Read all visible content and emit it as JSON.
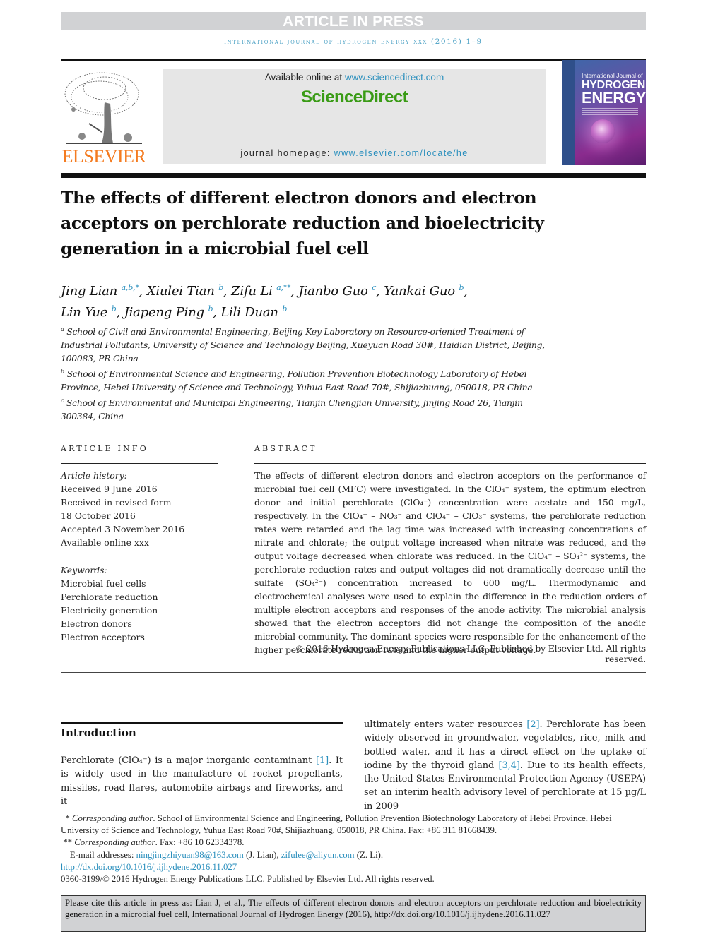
{
  "banner": {
    "label": "ARTICLE IN PRESS"
  },
  "journal_line": "international journal of hydrogen energy xxx (2016) 1–9",
  "header": {
    "publisher_logo_text": "ELSEVIER",
    "available_prefix": "Available online at ",
    "available_link": "www.sciencedirect.com",
    "sciencedirect_logo": "ScienceDirect",
    "homepage_prefix": "journal homepage: ",
    "homepage_link": "www.elsevier.com/locate/he",
    "cover": {
      "line1": "International Journal of",
      "line2": "HYDROGEN",
      "line3": "ENERGY"
    }
  },
  "title": "The effects of different electron donors and electron acceptors on perchlorate reduction and bioelectricity generation in a microbial fuel cell",
  "authors": [
    {
      "name": "Jing Lian",
      "sup": "a,b,*"
    },
    {
      "name": "Xiulei Tian",
      "sup": "b"
    },
    {
      "name": "Zifu Li",
      "sup": "a,**"
    },
    {
      "name": "Jianbo Guo",
      "sup": "c"
    },
    {
      "name": "Yankai Guo",
      "sup": "b"
    },
    {
      "name": "Lin Yue",
      "sup": "b"
    },
    {
      "name": "Jiapeng Ping",
      "sup": "b"
    },
    {
      "name": "Lili Duan",
      "sup": "b"
    }
  ],
  "affiliations": [
    {
      "mark": "a",
      "text": "School of Civil and Environmental Engineering, Beijing Key Laboratory on Resource-oriented Treatment of Industrial Pollutants, University of Science and Technology Beijing, Xueyuan Road 30#, Haidian District, Beijing, 100083, PR China"
    },
    {
      "mark": "b",
      "text": "School of Environmental Science and Engineering, Pollution Prevention Biotechnology Laboratory of Hebei Province, Hebei University of Science and Technology, Yuhua East Road 70#, Shijiazhuang, 050018, PR China"
    },
    {
      "mark": "c",
      "text": "School of Environmental and Municipal Engineering, Tianjin Chengjian University, Jinjing Road 26, Tianjin 300384, China"
    }
  ],
  "article_info": {
    "heading": "ARTICLE INFO",
    "history_label": "Article history:",
    "history": [
      "Received 9 June 2016",
      "Received in revised form",
      "18 October 2016",
      "Accepted 3 November 2016",
      "Available online xxx"
    ],
    "keywords_label": "Keywords:",
    "keywords": [
      "Microbial fuel cells",
      "Perchlorate reduction",
      "Electricity generation",
      "Electron donors",
      "Electron acceptors"
    ]
  },
  "abstract": {
    "heading": "ABSTRACT",
    "text": "The effects of different electron donors and electron acceptors on the performance of microbial fuel cell (MFC) were investigated. In the ClO₄⁻ system, the optimum electron donor and initial perchlorate (ClO₄⁻) concentration were acetate and 150 mg/L, respectively. In the ClO₄⁻ – NO₃⁻ and ClO₄⁻ – ClO₃⁻ systems, the perchlorate reduction rates were retarded and the lag time was increased with increasing concentrations of nitrate and chlorate; the output voltage increased when nitrate was reduced, and the output voltage decreased when chlorate was reduced. In the ClO₄⁻ – SO₄²⁻ systems, the perchlorate reduction rates and output voltages did not dramatically decrease until the sulfate (SO₄²⁻) concentration increased to 600 mg/L. Thermodynamic and electrochemical analyses were used to explain the difference in the reduction orders of multiple electron acceptors and responses of the anode activity. The microbial analysis showed that the electron acceptors did not change the composition of the anodic microbial community. The dominant species were responsible for the enhancement of the higher perchlorate reduction rate and the higher output voltage.",
    "copyright": "© 2016 Hydrogen Energy Publications LLC. Published by Elsevier Ltd. All rights reserved."
  },
  "introduction": {
    "heading": "Introduction",
    "col1": {
      "p1": "Perchlorate (ClO₄⁻) is a major inorganic contaminant ",
      "ref1": "[1]",
      "p2": ". It is widely used in the manufacture of rocket propellants, missiles, road flares, automobile airbags and fireworks, and it"
    },
    "col2": {
      "p1": "ultimately enters water resources ",
      "ref1": "[2]",
      "p2": ". Perchlorate has been widely observed in groundwater, vegetables, rice, milk and bottled water, and it has a direct effect on the uptake of iodine by the thyroid gland ",
      "ref2": "[3,4]",
      "p3": ". Due to its health effects, the United States Environmental Protection Agency (USEPA) set an interim health advisory level of perchlorate at 15 µg/L in 2009"
    }
  },
  "footnotes": {
    "fn1_mark": "*",
    "fn1_label": "Corresponding author",
    "fn1_text": ". School of Environmental Science and Engineering, Pollution Prevention Biotechnology Laboratory of Hebei Province, Hebei University of Science and Technology, Yuhua East Road 70#, Shijiazhuang, 050018, PR China. Fax: +86 311 81668439.",
    "fn2_mark": "**",
    "fn2_label": "Corresponding author",
    "fn2_text": ". Fax: +86 10 62334378.",
    "email_prefix": "E-mail addresses: ",
    "email1": "ningjingzhiyuan98@163.com",
    "email1_owner": " (J. Lian), ",
    "email2": "zifulee@aliyun.com",
    "email2_owner": " (Z. Li).",
    "doi": "http://dx.doi.org/10.1016/j.ijhydene.2016.11.027",
    "issn_line": "0360-3199/© 2016 Hydrogen Energy Publications LLC. Published by Elsevier Ltd. All rights reserved."
  },
  "citation_box": "Please cite this article in press as: Lian J, et al., The effects of different electron donors and electron acceptors on perchlorate reduction and bioelectricity generation in a microbial fuel cell, International Journal of Hydrogen Energy (2016), http://dx.doi.org/10.1016/j.ijhydene.2016.11.027",
  "colors": {
    "link": "#2a8fbd",
    "sciencedirect_green": "#3a9b16",
    "elsevier_orange": "#f47b20",
    "banner_gray": "#d1d2d4"
  }
}
